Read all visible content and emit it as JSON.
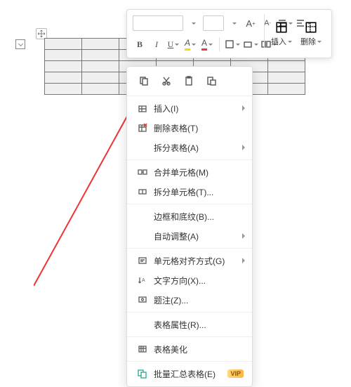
{
  "toolbar": {
    "font_value": "",
    "size_value": "",
    "increase_font": "A⁺",
    "decrease_font": "A⁻",
    "bold": "B",
    "italic": "I",
    "underline": "U",
    "font_effect": "A",
    "insert_label": "插入",
    "delete_label": "删除"
  },
  "context_menu": {
    "items": [
      {
        "label": "插入(I)",
        "has_sub": true,
        "icon": "insert"
      },
      {
        "label": "删除表格(T)",
        "icon": "delete-table"
      },
      {
        "label": "拆分表格(A)",
        "has_sub": true
      },
      {
        "label": "合并单元格(M)",
        "icon": "merge"
      },
      {
        "label": "拆分单元格(T)...",
        "icon": "split"
      },
      {
        "label": "边框和底纹(B)..."
      },
      {
        "label": "自动调整(A)",
        "has_sub": true
      },
      {
        "label": "单元格对齐方式(G)",
        "has_sub": true,
        "icon": "align"
      },
      {
        "label": "文字方向(X)...",
        "icon": "text-dir"
      },
      {
        "label": "题注(Z)...",
        "icon": "caption"
      },
      {
        "label": "表格属性(R)..."
      },
      {
        "label": "表格美化",
        "icon": "beautify"
      },
      {
        "label": "批量汇总表格(E)",
        "icon": "batch",
        "vip": true
      }
    ]
  }
}
